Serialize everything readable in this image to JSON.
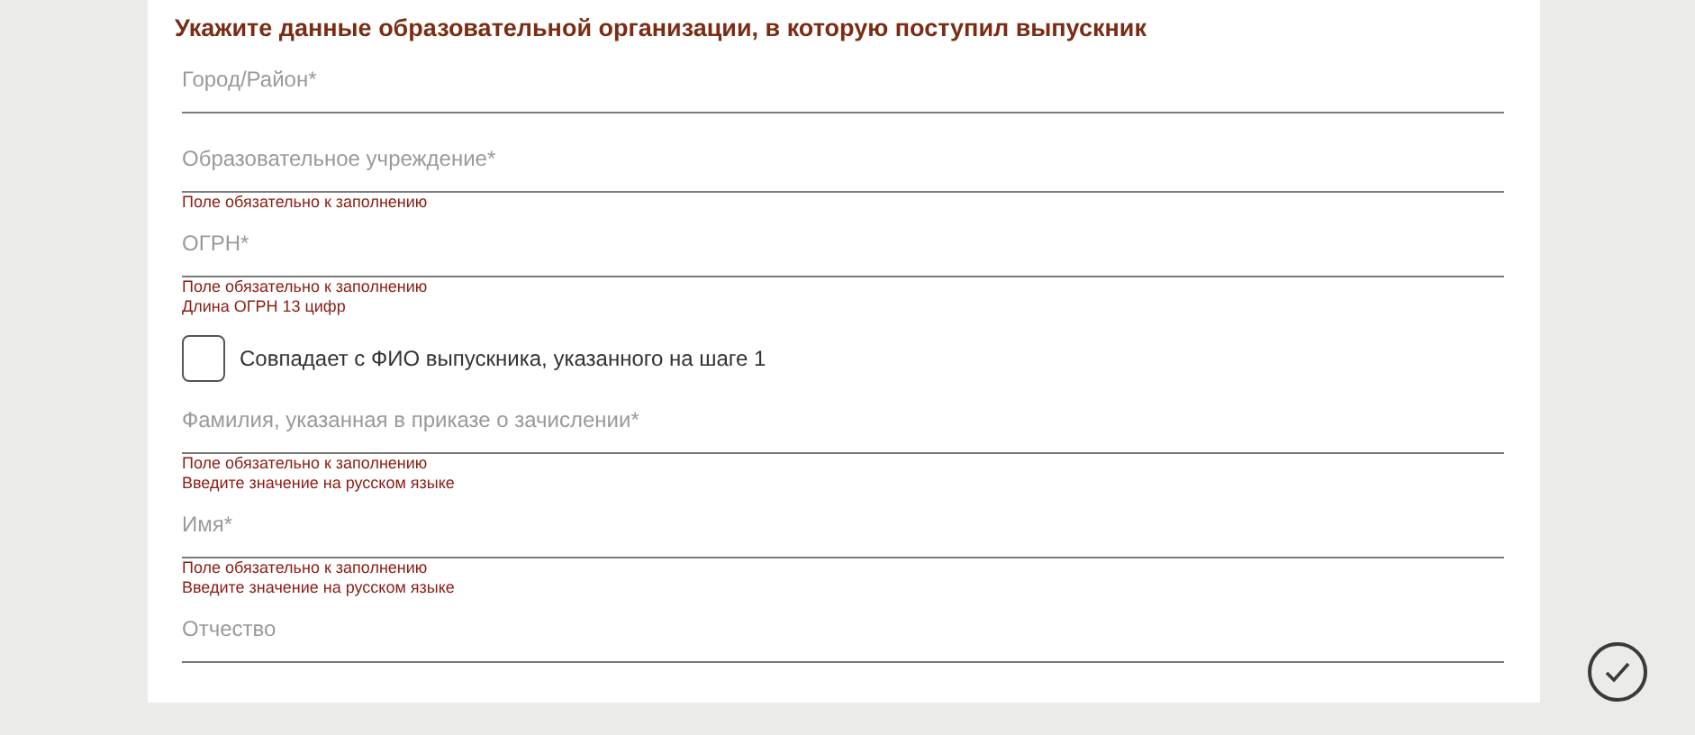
{
  "heading": "Укажите данные образовательной организации, в которую поступил выпускник",
  "fields": [
    {
      "label": "Город/Район*"
    },
    {
      "label": "Образовательное учреждение*",
      "errors": [
        "Поле обязательно к заполнению"
      ]
    },
    {
      "label": "ОГРН*",
      "errors": [
        "Поле обязательно к заполнению",
        "Длина ОГРН 13 цифр"
      ]
    },
    {
      "kind": "checkbox",
      "label": "Совпадает с ФИО выпускника, указанного на шаге 1",
      "checked": false
    },
    {
      "label": "Фамилия, указанная в приказе о зачислении*",
      "errors": [
        "Поле обязательно к заполнению",
        "Введите значение на русском языке"
      ]
    },
    {
      "label": "Имя*",
      "errors": [
        "Поле обязательно к заполнению",
        "Введите значение на русском языке"
      ]
    },
    {
      "label": "Отчество"
    }
  ]
}
